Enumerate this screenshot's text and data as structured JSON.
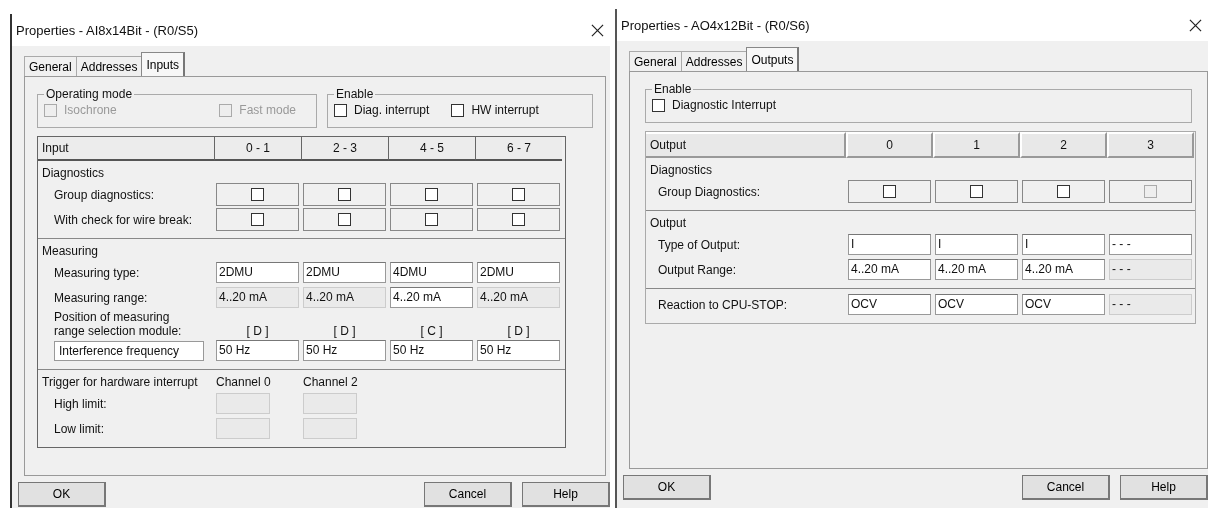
{
  "dialogs": [
    {
      "title": "Properties - AI8x14Bit - (R0/S5)",
      "tabs": [
        {
          "label": "General",
          "selected": false
        },
        {
          "label": "Addresses",
          "selected": false
        },
        {
          "label": "Inputs",
          "selected": true
        }
      ],
      "groups": [
        {
          "title": "Operating mode",
          "options": [
            {
              "label": "Isochrone",
              "checked": false,
              "disabled": true
            },
            {
              "label": "Fast mode",
              "checked": false,
              "disabled": true
            }
          ]
        },
        {
          "title": "Enable",
          "options": [
            {
              "label": "Diag. interrupt",
              "checked": false,
              "disabled": false
            },
            {
              "label": "HW interrupt",
              "checked": false,
              "disabled": false
            }
          ]
        }
      ],
      "table": {
        "header": "Input",
        "columns": [
          "0 - 1",
          "2 - 3",
          "4 - 5",
          "6 - 7"
        ],
        "sections": [
          {
            "title": "Diagnostics",
            "rows": [
              {
                "label": "Group diagnostics:",
                "cells": [
                  {
                    "kind": "check",
                    "checked": false,
                    "disabled": false
                  },
                  {
                    "kind": "check",
                    "checked": false,
                    "disabled": false
                  },
                  {
                    "kind": "check",
                    "checked": false,
                    "disabled": false
                  },
                  {
                    "kind": "check",
                    "checked": false,
                    "disabled": false
                  }
                ]
              },
              {
                "label": "With check for wire break:",
                "cells": [
                  {
                    "kind": "check",
                    "checked": false,
                    "disabled": false
                  },
                  {
                    "kind": "check",
                    "checked": false,
                    "disabled": false
                  },
                  {
                    "kind": "check",
                    "checked": false,
                    "disabled": false
                  },
                  {
                    "kind": "check",
                    "checked": false,
                    "disabled": false
                  }
                ]
              }
            ]
          },
          {
            "title": "Measuring",
            "rows": [
              {
                "label": "Measuring type:",
                "cells": [
                  {
                    "kind": "field",
                    "value": "2DMU",
                    "disabled": false
                  },
                  {
                    "kind": "field",
                    "value": "2DMU",
                    "disabled": false
                  },
                  {
                    "kind": "field",
                    "value": "4DMU",
                    "disabled": false
                  },
                  {
                    "kind": "field",
                    "value": "2DMU",
                    "disabled": false
                  }
                ]
              },
              {
                "label": "Measuring range:",
                "cells": [
                  {
                    "kind": "field",
                    "value": "4..20 mA",
                    "disabled": true
                  },
                  {
                    "kind": "field",
                    "value": "4..20 mA",
                    "disabled": true
                  },
                  {
                    "kind": "field",
                    "value": "4..20 mA",
                    "disabled": false
                  },
                  {
                    "kind": "field",
                    "value": "4..20 mA",
                    "disabled": true
                  }
                ]
              },
              {
                "label": "Position of measuring\nrange selection module:",
                "cells": [
                  {
                    "kind": "text",
                    "value": "[ D ]"
                  },
                  {
                    "kind": "text",
                    "value": "[ D ]"
                  },
                  {
                    "kind": "text",
                    "value": "[ C ]"
                  },
                  {
                    "kind": "text",
                    "value": "[ D ]"
                  }
                ]
              },
              {
                "label": "Interference frequency",
                "boxed": true,
                "cells": [
                  {
                    "kind": "field",
                    "value": "50 Hz",
                    "disabled": false
                  },
                  {
                    "kind": "field",
                    "value": "50 Hz",
                    "disabled": false
                  },
                  {
                    "kind": "field",
                    "value": "50 Hz",
                    "disabled": false
                  },
                  {
                    "kind": "field",
                    "value": "50 Hz",
                    "disabled": false
                  }
                ]
              }
            ]
          },
          {
            "title": "Trigger for hardware interrupt",
            "compact": true,
            "captions": [
              "Channel 0",
              "Channel 2"
            ],
            "rows": [
              {
                "label": "High limit:",
                "cells": [
                  {
                    "kind": "field",
                    "disabled": true
                  },
                  {
                    "kind": "field",
                    "disabled": true
                  }
                ]
              },
              {
                "label": "Low limit:",
                "cells": [
                  {
                    "kind": "field",
                    "disabled": true
                  },
                  {
                    "kind": "field",
                    "disabled": true
                  }
                ]
              }
            ]
          }
        ]
      },
      "buttons": [
        "OK",
        "Cancel",
        "Help"
      ]
    },
    {
      "title": "Properties - AO4x12Bit - (R0/S6)",
      "tabs": [
        {
          "label": "General",
          "selected": false
        },
        {
          "label": "Addresses",
          "selected": false
        },
        {
          "label": "Outputs",
          "selected": true
        }
      ],
      "groups": [
        {
          "title": "Enable",
          "options": [
            {
              "label": "Diagnostic Interrupt",
              "checked": false,
              "disabled": false
            }
          ]
        }
      ],
      "table": {
        "header": "Output",
        "columns": [
          "0",
          "1",
          "2",
          "3"
        ],
        "sections": [
          {
            "title": "Diagnostics",
            "rows": [
              {
                "label": "Group Diagnostics:",
                "cells": [
                  {
                    "kind": "check",
                    "checked": false,
                    "disabled": false
                  },
                  {
                    "kind": "check",
                    "checked": false,
                    "disabled": false
                  },
                  {
                    "kind": "check",
                    "checked": false,
                    "disabled": false
                  },
                  {
                    "kind": "check",
                    "checked": false,
                    "disabled": true
                  }
                ]
              }
            ]
          },
          {
            "title": "Output",
            "rows": [
              {
                "label": "Type of Output:",
                "cells": [
                  {
                    "kind": "field",
                    "value": "I",
                    "disabled": false
                  },
                  {
                    "kind": "field",
                    "value": "I",
                    "disabled": false
                  },
                  {
                    "kind": "field",
                    "value": "I",
                    "disabled": false
                  },
                  {
                    "kind": "field",
                    "value": "- - -",
                    "disabled": false
                  }
                ]
              },
              {
                "label": "Output Range:",
                "cells": [
                  {
                    "kind": "field",
                    "value": "4..20 mA",
                    "disabled": false
                  },
                  {
                    "kind": "field",
                    "value": "4..20 mA",
                    "disabled": false
                  },
                  {
                    "kind": "field",
                    "value": "4..20 mA",
                    "disabled": false
                  },
                  {
                    "kind": "field",
                    "value": "- - -",
                    "disabled": true
                  }
                ]
              }
            ]
          },
          {
            "rows": [
              {
                "label": "Reaction to CPU-STOP:",
                "cells": [
                  {
                    "kind": "field",
                    "value": "OCV",
                    "disabled": false
                  },
                  {
                    "kind": "field",
                    "value": "OCV",
                    "disabled": false
                  },
                  {
                    "kind": "field",
                    "value": "OCV",
                    "disabled": false
                  },
                  {
                    "kind": "field",
                    "value": "- - -",
                    "disabled": true
                  }
                ]
              }
            ]
          }
        ]
      },
      "buttons": [
        "OK",
        "Cancel",
        "Help"
      ]
    }
  ]
}
